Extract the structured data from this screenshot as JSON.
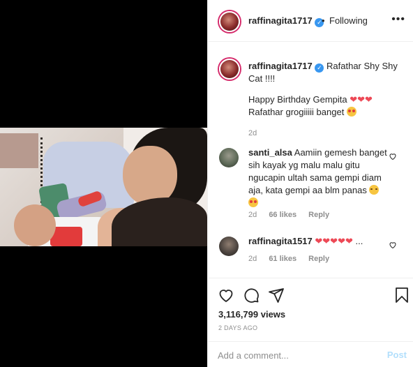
{
  "header": {
    "username": "raffinagita1717",
    "separator": "•",
    "follow_label": "Following",
    "more_label": "•••"
  },
  "caption": {
    "username": "raffinagita1717",
    "line1": "Rafathar Shy Shy Cat !!!!",
    "line2": "Happy Birthday Gempita",
    "line3": "Rafathar grogiiiii banget",
    "age": "2d"
  },
  "comments": [
    {
      "username": "santi_alsa",
      "text": "Aamiin gemesh banget sih kayak yg malu malu gitu ngucapin ultah sama gempi diam aja, kata gempi aa blm panas",
      "age": "2d",
      "likes": "66 likes",
      "reply": "Reply"
    },
    {
      "username": "raffinagita1517",
      "text": "",
      "more": "...",
      "age": "2d",
      "likes": "61 likes",
      "reply": "Reply"
    }
  ],
  "stats": {
    "views": "3,116,799 views",
    "posted": "2 DAYS AGO"
  },
  "add_comment": {
    "placeholder": "Add a comment...",
    "post_label": "Post"
  },
  "icons": {
    "verified": "verified-badge-icon",
    "heart": "heart-icon",
    "comment": "comment-icon",
    "share": "share-icon",
    "save": "bookmark-icon",
    "more": "more-icon"
  },
  "colors": {
    "accent": "#3897f0",
    "story_ring": "#d52b6b",
    "heart_red": "#ed4956",
    "muted": "#8e8e8e",
    "post_disabled": "#b2dffc"
  }
}
